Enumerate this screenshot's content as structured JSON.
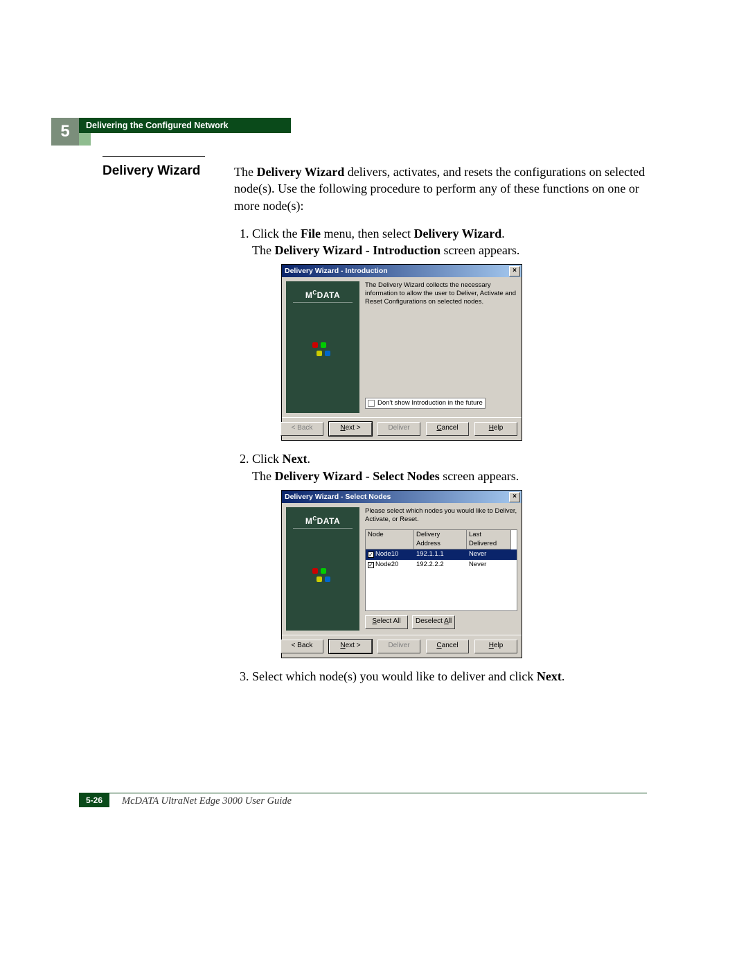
{
  "chapterNumber": "5",
  "headerBar": "Delivering the Configured Network",
  "sectionTitle": "Delivery Wizard",
  "intro": {
    "pre": "The ",
    "bold": "Delivery Wizard",
    "post": " delivers, activates, and resets the configurations on selected node(s). Use the following procedure to perform any of these functions on one or more node(s):"
  },
  "step1": {
    "pre": "Click the ",
    "b1": "File",
    "mid": " menu, then select ",
    "b2": "Delivery Wizard",
    "post": ".",
    "sub_pre": "The ",
    "sub_b": "Delivery Wizard - Introduction",
    "sub_post": " screen appears."
  },
  "step2": {
    "pre": "Click ",
    "b1": "Next",
    "post": ".",
    "sub_pre": "The ",
    "sub_b": "Delivery Wizard - Select Nodes",
    "sub_post": " screen appears."
  },
  "step3": {
    "pre": "Select which node(s) you would like to deliver and click ",
    "b1": "Next",
    "post": "."
  },
  "brand": {
    "pre": "M",
    "c": "C",
    "post": "DATA"
  },
  "dialog1": {
    "title": "Delivery Wizard - Introduction",
    "description": "The Delivery Wizard collects the necessary information to allow the user to Deliver, Activate and Reset Configurations on selected nodes.",
    "checkboxLabel": "Don't show Introduction in the future"
  },
  "dialog2": {
    "title": "Delivery Wizard - Select Nodes",
    "description": "Please select which nodes you would like to Deliver, Activate, or Reset.",
    "headers": {
      "node": "Node",
      "addr": "Delivery Address",
      "last": "Last Delivered"
    },
    "rows": [
      {
        "name": "Node10",
        "addr": "192.1.1.1",
        "last": "Never"
      },
      {
        "name": "Node20",
        "addr": "192.2.2.2",
        "last": "Never"
      }
    ],
    "selectAll": "Select All",
    "deselectAll": "Deselect All"
  },
  "buttons": {
    "back": "< Back",
    "next_pre": "N",
    "next_post": "ext >",
    "deliver": "Deliver",
    "cancel_pre": "C",
    "cancel_post": "ancel",
    "help_pre": "H",
    "help_post": "elp"
  },
  "selectBtns": {
    "selAll_u": "S",
    "selAll_r": "elect All",
    "desAll_pre": "Deselect ",
    "desAll_u": "A",
    "desAll_post": "ll"
  },
  "footer": {
    "pageNum": "5-26",
    "bookTitle": "McDATA UltraNet Edge 3000 User Guide"
  }
}
